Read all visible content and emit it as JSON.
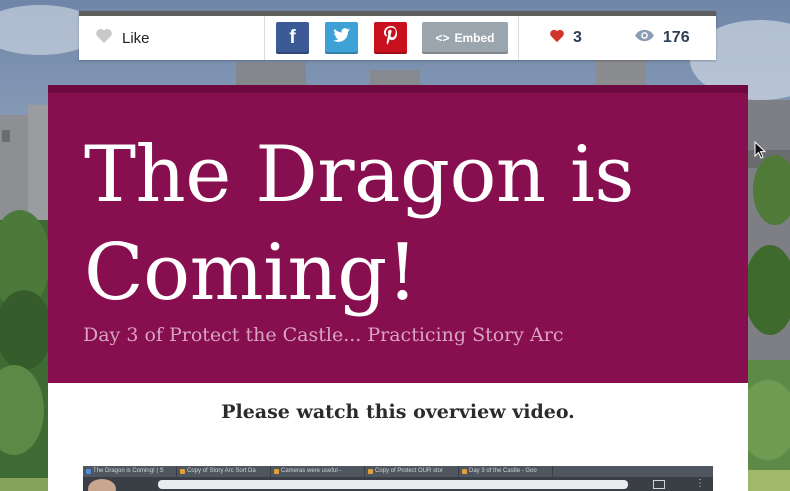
{
  "sharebar": {
    "like_label": "Like",
    "social": {
      "facebook": "f",
      "twitter_icon": "twitter-bird-icon",
      "pinterest_icon": "pinterest-p-icon"
    },
    "embed_label": "Embed",
    "embed_code_glyph": "<>",
    "likes_count": "3",
    "views_count": "176"
  },
  "hero": {
    "title": "The Dragon is Coming!",
    "subtitle": "Day 3 of Protect the Castle... Practicing Story Arc"
  },
  "content": {
    "heading": "Please watch this overview video.",
    "video_tabs": [
      "The Dragon is Coming! | S",
      "Copy of Story Arc Sort Da",
      "Cameras were useful -",
      "Copy of Protect OUR stor",
      "Day 3 of the Castle - Goo"
    ]
  },
  "colors": {
    "hero_bg": "#870e4f",
    "heart": "#d0342c",
    "facebook": "#3b5a96",
    "twitter": "#3fa2d6",
    "pinterest": "#c8101e",
    "embed": "#9aa5ae"
  }
}
